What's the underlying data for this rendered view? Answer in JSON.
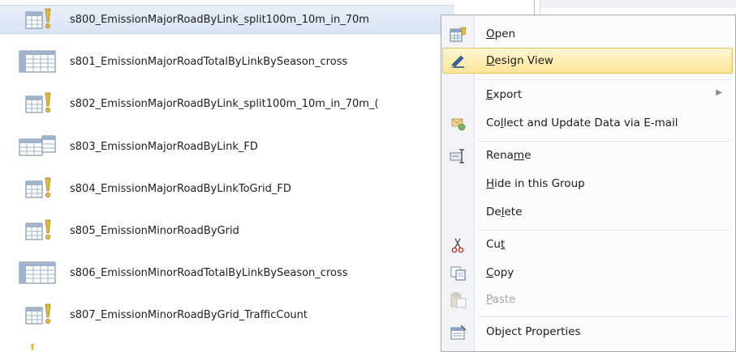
{
  "objects": [
    {
      "label": "s800_EmissionMajorRoadByLink_split100m_10m_in_70m",
      "icon": "make-table-query-icon"
    },
    {
      "label": "s801_EmissionMajorRoadTotalByLinkBySeason_cross",
      "icon": "crosstab-query-icon"
    },
    {
      "label": "s802_EmissionMajorRoadByLink_split100m_10m_in_70m_(",
      "icon": "make-table-query-icon"
    },
    {
      "label": "s803_EmissionMajorRoadByLink_FD",
      "icon": "append-query-icon"
    },
    {
      "label": "s804_EmissionMajorRoadByLinkToGrid_FD",
      "icon": "make-table-query-icon"
    },
    {
      "label": "s805_EmissionMinorRoadByGrid",
      "icon": "make-table-query-icon"
    },
    {
      "label": "s806_EmissionMinorRoadTotalByLinkBySeason_cross",
      "icon": "crosstab-query-icon"
    },
    {
      "label": "s807_EmissionMinorRoadByGrid_TrafficCount",
      "icon": "make-table-query-icon"
    }
  ],
  "context_menu": {
    "open": {
      "pre": "",
      "key": "O",
      "post": "pen",
      "icon": "open-icon"
    },
    "design_view": {
      "pre": "",
      "key": "D",
      "post": "esign View",
      "icon": "design-view-icon"
    },
    "export": {
      "pre": "",
      "key": "E",
      "post": "xport",
      "icon": "",
      "arrow": "▶"
    },
    "collect": {
      "pre": "Co",
      "key": "l",
      "post": "lect and Update Data via E-mail",
      "icon": "collect-data-icon"
    },
    "rename": {
      "pre": "Rena",
      "key": "m",
      "post": "e",
      "icon": "rename-icon"
    },
    "hide": {
      "pre": "",
      "key": "H",
      "post": "ide in this Group",
      "icon": ""
    },
    "delete": {
      "pre": "De",
      "key": "l",
      "post": "ete",
      "icon": ""
    },
    "cut": {
      "pre": "Cu",
      "key": "t",
      "post": "",
      "icon": "scissors-icon"
    },
    "copy": {
      "pre": "",
      "key": "C",
      "post": "opy",
      "icon": "copy-icon"
    },
    "paste": {
      "pre": "",
      "key": "P",
      "post": "aste",
      "icon": "paste-icon"
    },
    "properties": {
      "pre": "Ob",
      "key": "j",
      "post": "ect Properties",
      "icon": "properties-icon"
    }
  },
  "colors": {
    "highlight": "#ffe596",
    "selected_row": "#dce6f4",
    "menu_border": "#a7abb0"
  }
}
